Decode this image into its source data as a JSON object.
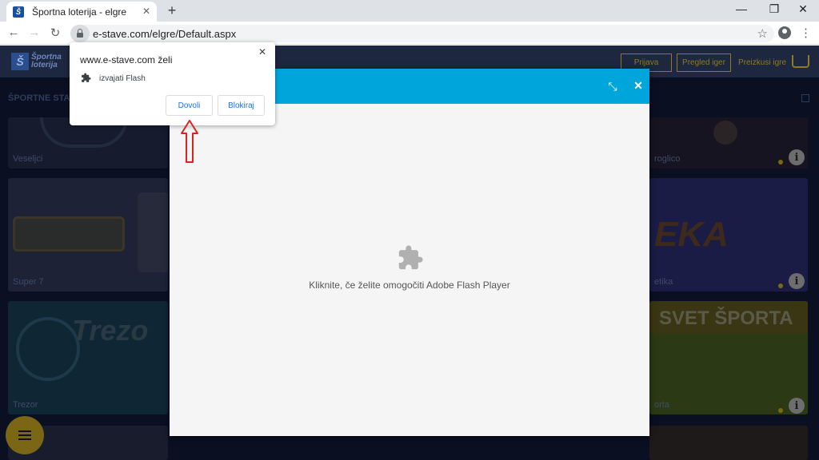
{
  "tab": {
    "title": "Športna loterija - elgre",
    "close": "✕",
    "favicon_text": "Š"
  },
  "newtab_label": "+",
  "window": {
    "minimize": "—",
    "restore": "❐",
    "close": "✕"
  },
  "toolbar": {
    "back": "←",
    "forward": "→",
    "reload": "↻",
    "star": "☆",
    "menu": "⋮"
  },
  "address": {
    "url": "e-stave.com/elgre/Default.aspx"
  },
  "site": {
    "logo_lines": [
      "Športna",
      "loterija"
    ],
    "logo_mark": "Š",
    "header_buttons": [
      "Prijava",
      "Pregled iger"
    ],
    "header_link": "Preizkusi igre",
    "subnav": "ŠPORTNE STAVE",
    "games": [
      "Veseljci",
      "Super 7",
      "Trezor",
      "roglico",
      "etika",
      "orta"
    ]
  },
  "modal": {
    "collapse": "⤡",
    "close": "✕",
    "flash_message": "Kliknite, če želite omogočiti Adobe Flash Player"
  },
  "permission": {
    "title": "www.e-stave.com želi",
    "close": "✕",
    "item": "izvajati Flash",
    "allow": "Dovoli",
    "block": "Blokiraj"
  },
  "colors": {
    "modal_header": "#00a5dc",
    "button_text": "#1a73e8",
    "arrow": "#e02020"
  }
}
